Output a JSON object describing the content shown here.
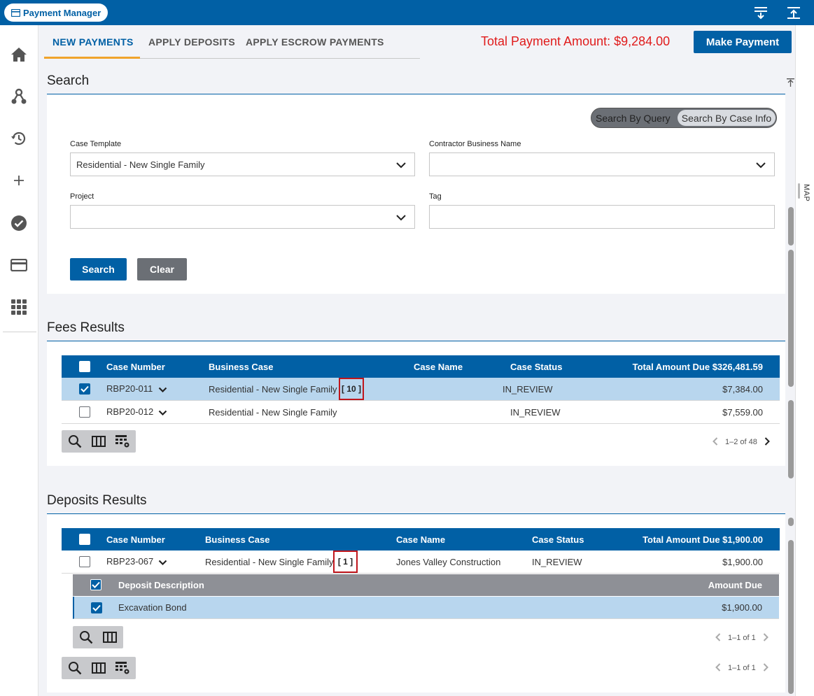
{
  "app": {
    "title": "Payment Manager"
  },
  "tabs": [
    {
      "label": "NEW PAYMENTS",
      "active": true
    },
    {
      "label": "APPLY DEPOSITS",
      "active": false
    },
    {
      "label": "APPLY ESCROW PAYMENTS",
      "active": false
    }
  ],
  "header": {
    "total_amount": "Total Payment Amount: $9,284.00",
    "make_payment_label": "Make Payment"
  },
  "search": {
    "title": "Search",
    "toggle_left": "Search By Query",
    "toggle_right": "Search By Case Info",
    "fields": {
      "case_template_label": "Case Template",
      "case_template_value": "Residential - New Single Family",
      "contractor_label": "Contractor Business Name",
      "contractor_value": "",
      "project_label": "Project",
      "project_value": "",
      "tag_label": "Tag",
      "tag_value": ""
    },
    "search_button": "Search",
    "clear_button": "Clear"
  },
  "fees": {
    "title": "Fees Results",
    "columns": {
      "case_number": "Case Number",
      "business_case": "Business Case",
      "case_name": "Case Name",
      "case_status": "Case Status",
      "total": "Total Amount Due $326,481.59"
    },
    "rows": [
      {
        "case_number": "RBP20-011",
        "business_case": "Residential - New Single Family",
        "count": "[ 10 ]",
        "case_name": "",
        "case_status": "IN_REVIEW",
        "amount": "$7,384.00",
        "checked": true
      },
      {
        "case_number": "RBP20-012",
        "business_case": "Residential - New Single Family",
        "count": "",
        "case_name": "",
        "case_status": "IN_REVIEW",
        "amount": "$7,559.00",
        "checked": false
      }
    ],
    "pager": "1–2 of 48"
  },
  "deposits": {
    "title": "Deposits Results",
    "columns": {
      "case_number": "Case Number",
      "business_case": "Business Case",
      "case_name": "Case Name",
      "case_status": "Case Status",
      "total": "Total Amount Due $1,900.00"
    },
    "rows": [
      {
        "case_number": "RBP23-067",
        "business_case": "Residential - New Single Family",
        "count": "[ 1 ]",
        "case_name": "Jones Valley Construction",
        "case_status": "IN_REVIEW",
        "amount": "$1,900.00",
        "checked": false
      }
    ],
    "sub": {
      "col_description": "Deposit Description",
      "col_amount": "Amount Due",
      "rows": [
        {
          "description": "Excavation Bond",
          "amount": "$1,900.00",
          "checked": true
        }
      ],
      "pager": "1–1 of 1"
    },
    "pager": "1–1 of 1"
  },
  "right_rail": {
    "label": "MAP"
  },
  "colors": {
    "primary": "#0160a5",
    "accent": "#f0a32b",
    "total_red": "#e01b1b",
    "selected_row": "#b8d6ee"
  },
  "icons": [
    "home-icon",
    "connections-icon",
    "history-icon",
    "add-icon",
    "check-circle-icon",
    "card-icon",
    "apps-grid-icon",
    "collapse-all-icon",
    "expand-all-icon"
  ]
}
